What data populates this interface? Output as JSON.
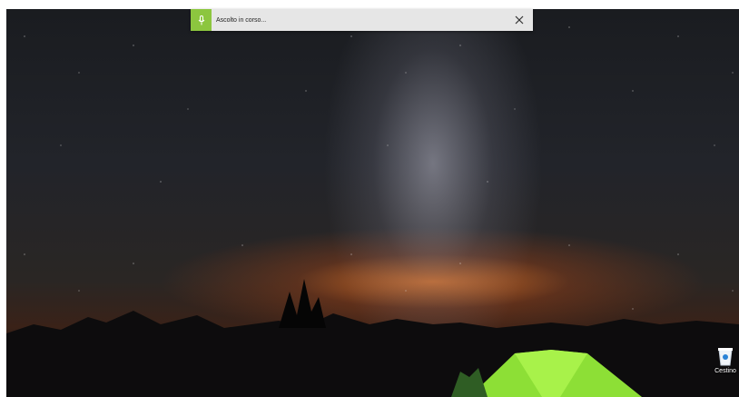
{
  "voice_bar": {
    "status_text": "Ascolto in corso...",
    "mic_icon": "microphone-icon",
    "close_icon": "close-icon",
    "accent_color": "#8cc63f"
  },
  "desktop": {
    "icons": [
      {
        "label": "Cestino",
        "icon": "recycle-bin-icon"
      }
    ]
  }
}
